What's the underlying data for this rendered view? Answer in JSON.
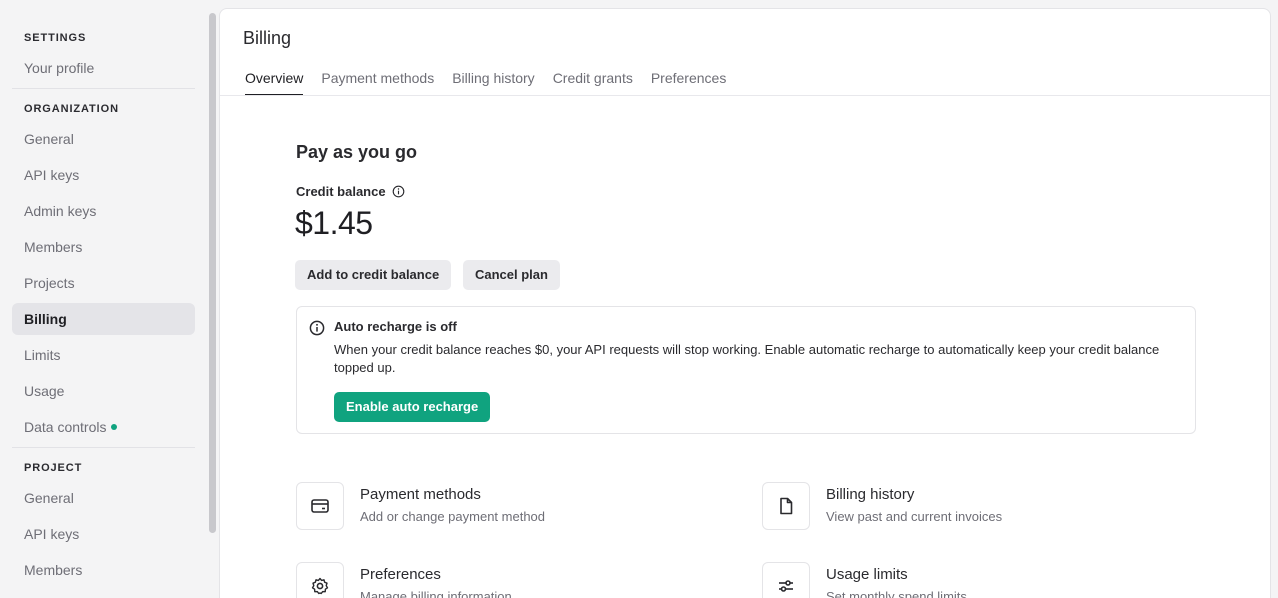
{
  "sidebar": {
    "sections": [
      {
        "title": "SETTINGS",
        "items": [
          {
            "label": "Your profile"
          }
        ]
      },
      {
        "title": "ORGANIZATION",
        "items": [
          {
            "label": "General"
          },
          {
            "label": "API keys"
          },
          {
            "label": "Admin keys"
          },
          {
            "label": "Members"
          },
          {
            "label": "Projects"
          },
          {
            "label": "Billing",
            "active": true
          },
          {
            "label": "Limits"
          },
          {
            "label": "Usage"
          },
          {
            "label": "Data controls",
            "badge": "green-dot"
          }
        ]
      },
      {
        "title": "PROJECT",
        "items": [
          {
            "label": "General"
          },
          {
            "label": "API keys"
          },
          {
            "label": "Members"
          }
        ]
      }
    ]
  },
  "page": {
    "title": "Billing",
    "tabs": [
      {
        "label": "Overview",
        "active": true
      },
      {
        "label": "Payment methods"
      },
      {
        "label": "Billing history"
      },
      {
        "label": "Credit grants"
      },
      {
        "label": "Preferences"
      }
    ]
  },
  "plan": {
    "title": "Pay as you go",
    "credit_label": "Credit balance",
    "balance": "$1.45",
    "add_button": "Add to credit balance",
    "cancel_button": "Cancel plan"
  },
  "notice": {
    "title": "Auto recharge is off",
    "body": "When your credit balance reaches $0, your API requests will stop working. Enable automatic recharge to automatically keep your credit balance topped up.",
    "button": "Enable auto recharge"
  },
  "cards": {
    "payment": {
      "title": "Payment methods",
      "subtitle": "Add or change payment method",
      "icon": "credit-card-icon"
    },
    "history": {
      "title": "Billing history",
      "subtitle": "View past and current invoices",
      "icon": "document-icon"
    },
    "preferences": {
      "title": "Preferences",
      "subtitle": "Manage billing information",
      "icon": "gear-icon"
    },
    "limits": {
      "title": "Usage limits",
      "subtitle": "Set monthly spend limits",
      "icon": "sliders-icon"
    }
  },
  "colors": {
    "accent": "#10a37f",
    "active_bg": "#e4e4e8"
  }
}
